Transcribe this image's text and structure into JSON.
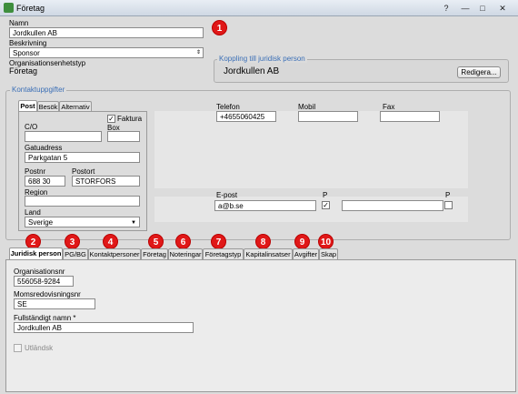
{
  "window": {
    "title": "Företag",
    "help": "?",
    "minimize": "—",
    "maximize": "□",
    "close": "✕"
  },
  "top": {
    "name_label": "Namn",
    "name_value": "Jordkullen AB",
    "desc_label": "Beskrivning",
    "desc_value": "Sponsor",
    "orgtype_label": "Organisationsenhetstyp",
    "orgtype_value": "Företag"
  },
  "legal_link": {
    "legend": "Koppling till juridisk person",
    "name": "Jordkullen AB",
    "edit_button": "Redigera..."
  },
  "contact": {
    "legend": "Kontaktuppgifter",
    "tabs": [
      "Post",
      "Besök",
      "Alternativ"
    ],
    "co_label": "C/O",
    "faktura_label": "Faktura",
    "faktura_checked": "✓",
    "box_label": "Box",
    "street_label": "Gatuadress",
    "street_value": "Parkgatan 5",
    "zip_label": "Postnr",
    "zip_value": "688 30",
    "city_label": "Postort",
    "city_value": "STORFORS",
    "region_label": "Region",
    "region_value": "",
    "country_label": "Land",
    "country_value": "Sverige",
    "phone_label": "Telefon",
    "phone_value": "+4655060425",
    "mobile_label": "Mobil",
    "mobile_value": "",
    "fax_label": "Fax",
    "fax_value": "",
    "email_label": "E-post",
    "email_value": "a@b.se",
    "p_label_1": "P",
    "p1_checked": "✓",
    "p_label_2": "P"
  },
  "badges": [
    "1",
    "2",
    "3",
    "4",
    "5",
    "6",
    "7",
    "8",
    "9",
    "10"
  ],
  "bottom_tabs": [
    "Juridisk person",
    "PG/BG",
    "Kontaktpersoner",
    "Företag",
    "Noteringar",
    "Företagstyp",
    "Kapitalinsatser",
    "Avgifter",
    "Skap"
  ],
  "juridisk": {
    "orgnr_label": "Organisationsnr",
    "orgnr_value": "556058-9284",
    "moms_label": "Momsredovisningsnr",
    "moms_value": "SE",
    "fullname_label": "Fullständigt namn *",
    "fullname_value": "Jordkullen AB",
    "foreign_label": "Utländsk"
  },
  "colors": {
    "badge": "#e01818",
    "legend": "#3b6fb6",
    "app_icon": "#3e8e3e"
  }
}
